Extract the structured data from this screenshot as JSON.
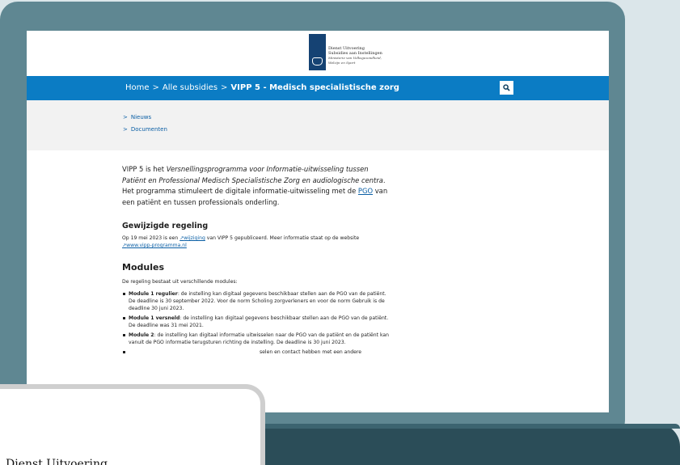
{
  "header": {
    "logo_line1": "Dienst Uitvoering",
    "logo_line2": "Subsidies aan Instellingen",
    "logo_line3": "Ministerie van Volksgezondheid,",
    "logo_line4": "Welzijn en Sport"
  },
  "breadcrumb": {
    "home": "Home",
    "sep": ">",
    "parent": "Alle subsidies",
    "current": "VIPP 5 - Medisch specialistische zorg"
  },
  "search": {
    "icon": "search-icon",
    "glyph": "🔍︎"
  },
  "subnav": [
    {
      "chevron": ">",
      "label": "Nieuws"
    },
    {
      "chevron": ">",
      "label": "Documenten"
    }
  ],
  "intro": {
    "p1": "VIPP 5 is het ",
    "p1_em": "Versnellingsprogramma voor Informatie-uitwisseling tussen Patiënt en Professional Medisch Specialistische Zorg en audiologische centra",
    "p1_rest": ". Het programma stimuleert de digitale informatie-uitwisseling met de ",
    "p1_link": "PGO",
    "p1_end": " van een patiënt en tussen professionals onderling."
  },
  "regeling": {
    "heading": "Gewijzigde regeling",
    "text1": "Op 19 mei 2023 is een ",
    "link1": "wijziging",
    "text2": " van VIPP 5 gepubliceerd. Meer informatie staat op de website ",
    "link2": "www.vipp-programma.nl"
  },
  "modules": {
    "heading": "Modules",
    "intro": "De regeling bestaat uit verschillende modules:",
    "items": [
      {
        "title": "Module 1 regulier",
        "text": ": de instelling kan digitaal gegevens beschikbaar stellen aan de PGO van de patiënt. De deadline is 30 september 2022. Voor de norm Scholing zorgverleners en voor de norm Gebruik is de deadline 30 juni 2023."
      },
      {
        "title": "Module 1 versneld",
        "text": ": de instelling kan digitaal gegevens beschikbaar stellen aan de PGO van de patiënt. De deadline was 31 mei 2021."
      },
      {
        "title": "Module 2",
        "text": ": de instelling kan digitaal informatie uitwisselen naar de PGO van de patiënt en de patiënt kan vanuit de PGO informatie terugsturen richting de instelling. De deadline is 30 juni 2023."
      },
      {
        "title": "",
        "text": "selen en contact hebben met een andere"
      }
    ]
  },
  "overlay": {
    "text": "Dienst Uitvoering"
  },
  "colors": {
    "nav_blue": "#0b7cc4",
    "frame": "#5f8792",
    "logo_blue": "#154273",
    "link": "#0b5fa5"
  }
}
